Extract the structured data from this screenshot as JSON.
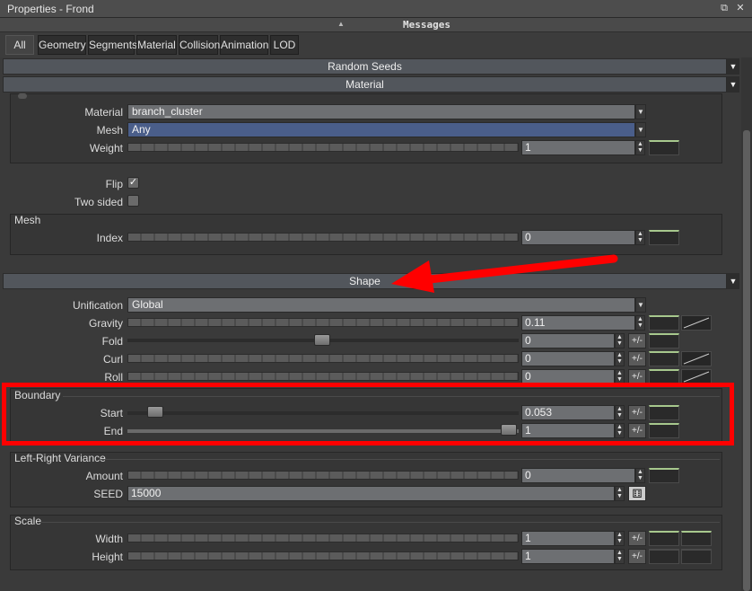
{
  "window": {
    "title": "Properties - Frond",
    "restore_btn": "⧉",
    "close_btn": "✕"
  },
  "messages": {
    "label": "Messages"
  },
  "tabs": [
    "All",
    "Geometry",
    "Segments",
    "Material",
    "Collision",
    "Animation",
    "LOD"
  ],
  "headers": {
    "random_seeds": "Random Seeds",
    "material": "Material",
    "shape": "Shape"
  },
  "material_group": {
    "material_label": "Material",
    "material_value": "branch_cluster",
    "mesh_label": "Mesh",
    "mesh_value": "Any",
    "weight_label": "Weight",
    "weight_value": "1"
  },
  "flip": {
    "label": "Flip",
    "checked": true
  },
  "two_sided": {
    "label": "Two sided",
    "checked": false
  },
  "mesh_group": {
    "title": "Mesh",
    "index_label": "Index",
    "index_value": "0"
  },
  "shape": {
    "unification_label": "Unification",
    "unification_value": "Global",
    "gravity_label": "Gravity",
    "gravity_value": "0.11",
    "fold_label": "Fold",
    "fold_value": "0",
    "curl_label": "Curl",
    "curl_value": "0",
    "roll_label": "Roll",
    "roll_value": "0"
  },
  "boundary": {
    "title": "Boundary",
    "start_label": "Start",
    "start_value": "0.053",
    "end_label": "End",
    "end_value": "1"
  },
  "lr_variance": {
    "title": "Left-Right Variance",
    "amount_label": "Amount",
    "amount_value": "0",
    "seed_label": "SEED",
    "seed_value": "15000"
  },
  "scale": {
    "title": "Scale",
    "width_label": "Width",
    "width_value": "1",
    "height_label": "Height",
    "height_value": "1"
  },
  "pm_label": "+/-",
  "colors": {
    "annotation": "#ff0000",
    "accent_green": "#a7c88d",
    "mesh_blue": "#4a5e8a"
  }
}
